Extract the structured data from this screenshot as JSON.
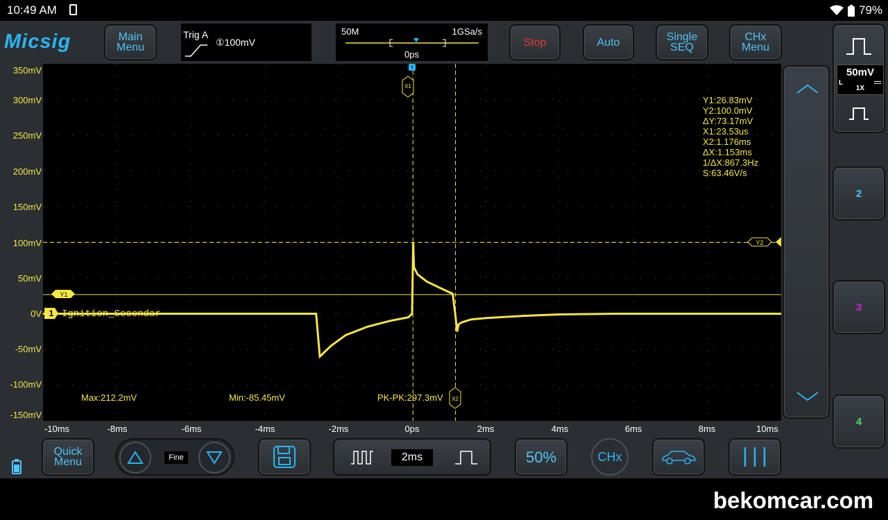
{
  "statusbar": {
    "time": "10:49 AM",
    "battery_pct": "79%"
  },
  "brand": "Micsig",
  "toolbar": {
    "main_menu": "Main\nMenu",
    "trigger": {
      "title": "Trig A",
      "level": "①100mV"
    },
    "timebase": {
      "memory": "50M",
      "sample_rate": "1GSa/s",
      "offset": "0ps"
    },
    "stop": "Stop",
    "auto": "Auto",
    "single_seq": "Single\nSEQ",
    "chx_menu": "CHx\nMenu"
  },
  "channel": {
    "number": "1",
    "label": "Ignition_Secondar",
    "scale": "50mV",
    "probe": "1X",
    "coupling": "L"
  },
  "y_axis_labels": [
    "350mV",
    "300mV",
    "250mV",
    "200mV",
    "150mV",
    "100mV",
    "50mV",
    "0V",
    "-50mV",
    "-100mV",
    "-150mV"
  ],
  "x_axis_labels": [
    "-10ms",
    "-8ms",
    "-6ms",
    "-4ms",
    "-2ms",
    "0ps",
    "2ms",
    "4ms",
    "6ms",
    "8ms",
    "10ms"
  ],
  "cursor_readout": [
    "Y1:26.83mV",
    "Y2:100.0mV",
    "ΔY:73.17mV",
    "X1:23.53us",
    "X2:1.176ms",
    "ΔX:1.153ms",
    "1/ΔX:867.3Hz",
    "S:63.46V/s"
  ],
  "cursor_tags": {
    "x1": "X1",
    "x2": "X2",
    "y1": "Y1",
    "y2": "Y2",
    "trigger": "T"
  },
  "measurements": {
    "max": "Max:212.2mV",
    "min": "Min:-85.45mV",
    "pkpk": "PK-PK:297.3mV"
  },
  "side_channels": [
    "2",
    "3",
    "4"
  ],
  "bottom_bar": {
    "quick_menu": "Quick\nMenu",
    "fine": "Fine",
    "timebase": "2ms",
    "fifty": "50%",
    "chx": "CHx"
  },
  "watermark": "bekomcar.com",
  "colors": {
    "ch1": "#f5e642",
    "ch2": "#4fc3f7",
    "ch3": "#d81bd8",
    "ch4": "#4cd964",
    "accent": "#29b6f6",
    "stop": "#e53935"
  },
  "chart_data": {
    "type": "line",
    "xunit": "ms",
    "yunit": "mV",
    "xlim": [
      -10,
      10
    ],
    "ylim": [
      -150,
      350
    ],
    "series": [
      {
        "name": "Ignition_Secondar",
        "x": [
          -10,
          -6.6,
          -2.6,
          -2.5,
          -2.2,
          -1.8,
          -1.2,
          -0.6,
          -0.1,
          0.0,
          0.03,
          0.05,
          0.15,
          0.4,
          0.8,
          1.1,
          1.17,
          1.22,
          1.26,
          1.35,
          1.6,
          2.0,
          3.0,
          4.0,
          5.5,
          7.0,
          10
        ],
        "y": [
          0,
          0,
          0,
          -60,
          -45,
          -30,
          -18,
          -10,
          -5,
          0,
          100,
          65,
          55,
          45,
          35,
          28,
          0,
          -25,
          -15,
          -12,
          -8,
          -6,
          -3,
          -1,
          0,
          0,
          0
        ]
      }
    ],
    "cursors": {
      "y1_mV": 26.83,
      "y2_mV": 100.0,
      "x1_ms": 0.02353,
      "x2_ms": 1.176
    }
  }
}
